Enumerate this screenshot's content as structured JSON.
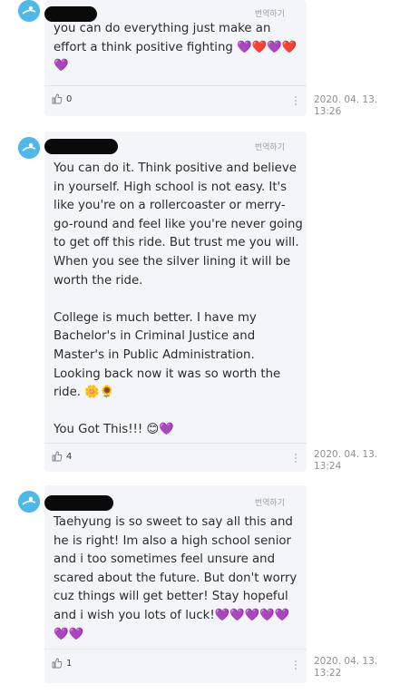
{
  "comments": [
    {
      "translate_label": "번역하기",
      "text": "you can do everything just make an effort a think positive fighting 💜❤️💜❤️💜",
      "likes": "0",
      "date": "2020. 04. 13.\n13:26",
      "avatar_icon": "user-avatar-icon"
    },
    {
      "translate_label": "번역하기",
      "text": "You can do it. Think positive and believe in yourself. High school is not easy. It's like you're on a rollercoaster or merry-go-round and feel like you're never going to get off this ride. But trust me you will. When you see the silver lining it will be worth the ride.\n\nCollege is much better. I have my Bachelor's in Criminal Justice and Master's in Public Administration. Looking back now it was so worth the ride. 🌼🌻\n\nYou Got This!!! 😊💜",
      "likes": "4",
      "date": "2020. 04. 13.\n13:24",
      "avatar_icon": "user-avatar-icon"
    },
    {
      "translate_label": "번역하기",
      "text": "Taehyung is so sweet to say all this and he is right! Im also a high school senior and i too sometimes feel unsure and scared about the future. But don't worry cuz things will get better! Stay hopeful and i wish you lots of luck!💜💜💜💜💜💜💜",
      "likes": "1",
      "date": "2020. 04. 13.\n13:22",
      "avatar_icon": "user-avatar-icon"
    }
  ],
  "colors": {
    "bubble": "#f3f5f8",
    "avatar": "#4fb8e6",
    "date": "#8a8f96"
  }
}
